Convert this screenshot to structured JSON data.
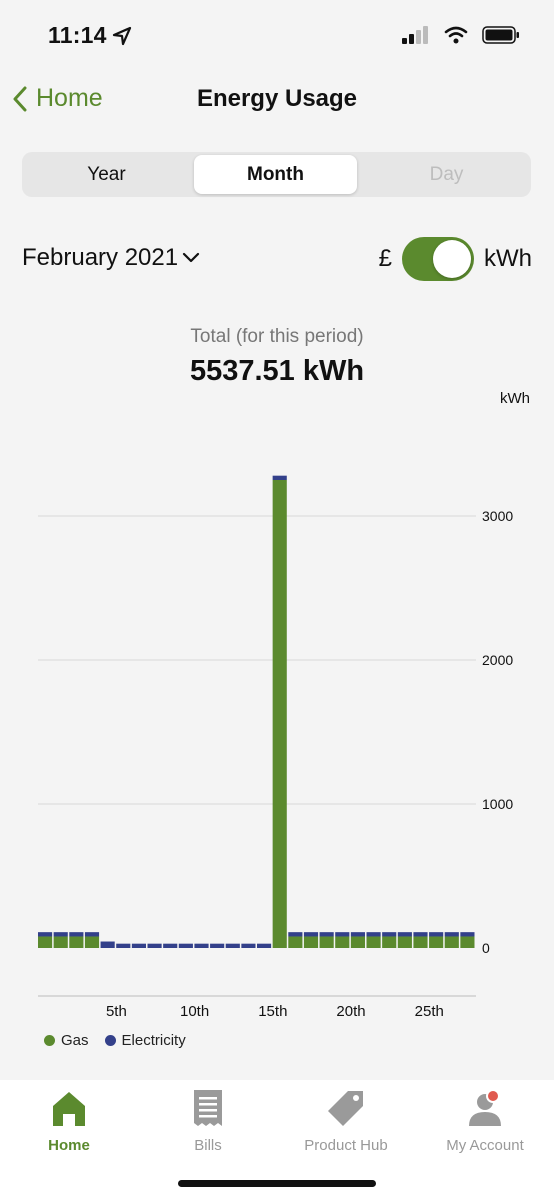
{
  "status": {
    "time": "11:14"
  },
  "nav": {
    "back_label": "Home",
    "title": "Energy Usage"
  },
  "segments": {
    "year": "Year",
    "month": "Month",
    "day": "Day",
    "selected": "Month"
  },
  "period": {
    "label": "February 2021"
  },
  "unit_toggle": {
    "left_label": "£",
    "right_label": "kWh",
    "on": true
  },
  "total": {
    "label": "Total  (for this period)",
    "value": "5537.51 kWh"
  },
  "chart_data": {
    "type": "bar",
    "stacked": true,
    "unit_label": "kWh",
    "y_ticks": [
      0,
      1000,
      2000,
      3000
    ],
    "ylim": [
      0,
      3300
    ],
    "x_tick_labels": [
      {
        "day": 5,
        "label": "5th"
      },
      {
        "day": 10,
        "label": "10th"
      },
      {
        "day": 15,
        "label": "15th"
      },
      {
        "day": 20,
        "label": "20th"
      },
      {
        "day": 25,
        "label": "25th"
      }
    ],
    "categories": [
      1,
      2,
      3,
      4,
      5,
      6,
      7,
      8,
      9,
      10,
      11,
      12,
      13,
      14,
      15,
      16,
      17,
      18,
      19,
      20,
      21,
      22,
      23,
      24,
      25,
      26,
      27,
      28
    ],
    "series": [
      {
        "name": "Gas",
        "color": "#5b8a2e",
        "values": [
          80,
          80,
          80,
          80,
          0,
          0,
          0,
          0,
          0,
          0,
          0,
          0,
          0,
          0,
          0,
          3250,
          80,
          80,
          80,
          80,
          80,
          80,
          80,
          80,
          80,
          80,
          80,
          80
        ]
      },
      {
        "name": "Electricity",
        "color": "#33408a",
        "values": [
          30,
          30,
          30,
          30,
          45,
          30,
          30,
          30,
          30,
          30,
          30,
          30,
          30,
          30,
          30,
          30,
          30,
          30,
          30,
          30,
          30,
          30,
          30,
          30,
          30,
          30,
          30,
          30
        ]
      }
    ],
    "grid": true,
    "legend_position": "bottom-left"
  },
  "legend": {
    "gas": "Gas",
    "electricity": "Electricity"
  },
  "tabs": [
    {
      "label": "Home",
      "icon": "home-icon",
      "active": true
    },
    {
      "label": "Bills",
      "icon": "receipt-icon",
      "active": false
    },
    {
      "label": "Product Hub",
      "icon": "tag-icon",
      "active": false
    },
    {
      "label": "My Account",
      "icon": "account-icon",
      "active": false
    }
  ],
  "colors": {
    "accent": "#5b8a2e",
    "electricity": "#33408a",
    "notification": "#e05a4f"
  }
}
